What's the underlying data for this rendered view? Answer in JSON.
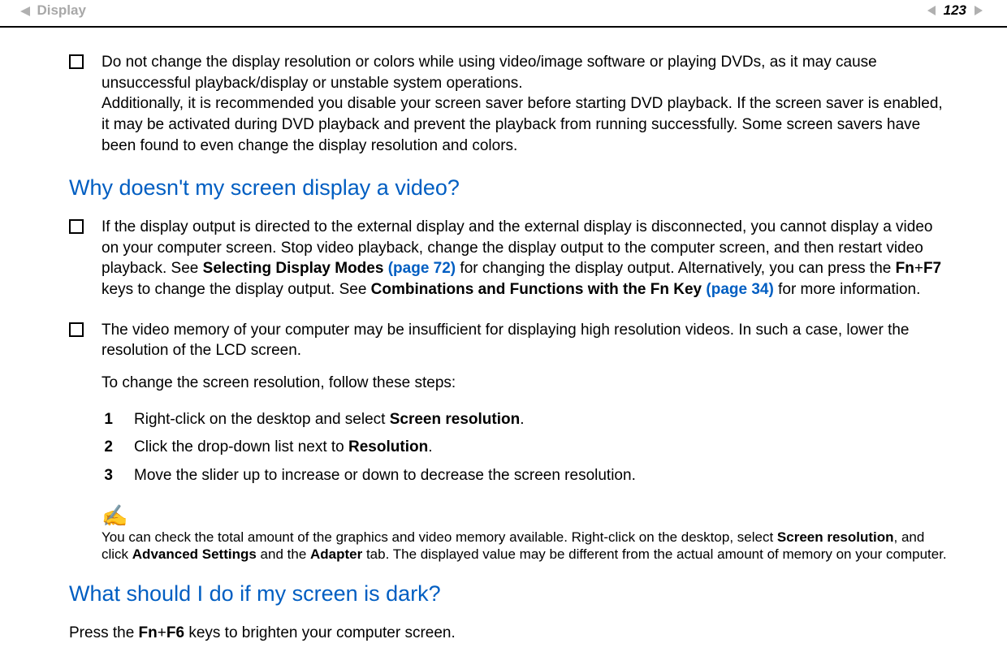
{
  "header": {
    "section": "Display",
    "page_number": "123"
  },
  "bullets": {
    "b1": "Do not change the display resolution or colors while using video/image software or playing DVDs, as it may cause unsuccessful playback/display or unstable system operations.\nAdditionally, it is recommended you disable your screen saver before starting DVD playback. If the screen saver is enabled, it may be activated during DVD playback and prevent the playback from running successfully. Some screen savers have been found to even change the display resolution and colors."
  },
  "q1": {
    "heading": "Why doesn't my screen display a video?",
    "b1_pre": "If the display output is directed to the external display and the external display is disconnected, you cannot display a video on your computer screen. Stop video playback, change the display output to the computer screen, and then restart video playback. See ",
    "b1_bold1": "Selecting Display Modes ",
    "b1_link1": "(page 72)",
    "b1_mid1": " for changing the display output. Alternatively, you can press the ",
    "b1_bold2": "Fn",
    "b1_plus": "+",
    "b1_bold3": "F7",
    "b1_mid2": " keys to change the display output. See ",
    "b1_bold4": "Combinations and Functions with the Fn Key ",
    "b1_link2": "(page 34)",
    "b1_post": " for more information.",
    "b2": "The video memory of your computer may be insufficient for displaying high resolution videos. In such a case, lower the resolution of the LCD screen.",
    "steps_intro": "To change the screen resolution, follow these steps:",
    "s1_pre": "Right-click on the desktop and select ",
    "s1_bold": "Screen resolution",
    "s1_post": ".",
    "s2_pre": "Click the drop-down list next to ",
    "s2_bold": "Resolution",
    "s2_post": ".",
    "s3": "Move the slider up to increase or down to decrease the screen resolution.",
    "note_pre": "You can check the total amount of the graphics and video memory available. Right-click on the desktop, select ",
    "note_b1": "Screen resolution",
    "note_mid1": ", and click ",
    "note_b2": "Advanced Settings",
    "note_mid2": " and the ",
    "note_b3": "Adapter",
    "note_post": " tab. The displayed value may be different from the actual amount of memory on your computer."
  },
  "q2": {
    "heading": "What should I do if my screen is dark?",
    "ans_pre": "Press the ",
    "ans_b1": "Fn",
    "ans_plus": "+",
    "ans_b2": "F6",
    "ans_post": " keys to brighten your computer screen."
  },
  "note_icon": "✍"
}
